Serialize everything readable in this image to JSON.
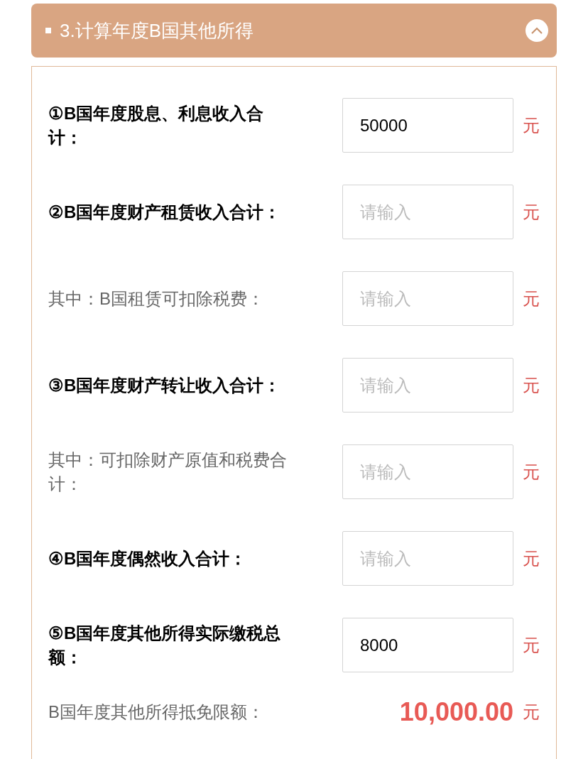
{
  "section": {
    "title": "3.计算年度B国其他所得",
    "expanded": true
  },
  "rows": [
    {
      "kind": "main",
      "label": "①B国年度股息、利息收入合计：",
      "value": "50000",
      "unit": "元"
    },
    {
      "kind": "main",
      "label": "②B国年度财产租赁收入合计：",
      "placeholder": "请输入",
      "unit": "元"
    },
    {
      "kind": "sub",
      "label": "其中：B国租赁可扣除税费：",
      "placeholder": "请输入",
      "unit": "元"
    },
    {
      "kind": "main",
      "label": "③B国年度财产转让收入合计：",
      "placeholder": "请输入",
      "unit": "元"
    },
    {
      "kind": "sub",
      "label": "其中：可扣除财产原值和税费合计：",
      "placeholder": "请输入",
      "unit": "元"
    },
    {
      "kind": "main",
      "label": "④B国年度偶然收入合计：",
      "placeholder": "请输入",
      "unit": "元"
    },
    {
      "kind": "main",
      "label": "⑤B国年度其他所得实际缴税总额：",
      "value": "8000",
      "unit": "元"
    }
  ],
  "result": {
    "label": "B国年度其他所得抵免限额：",
    "value": "10,000.00",
    "unit": "元"
  }
}
